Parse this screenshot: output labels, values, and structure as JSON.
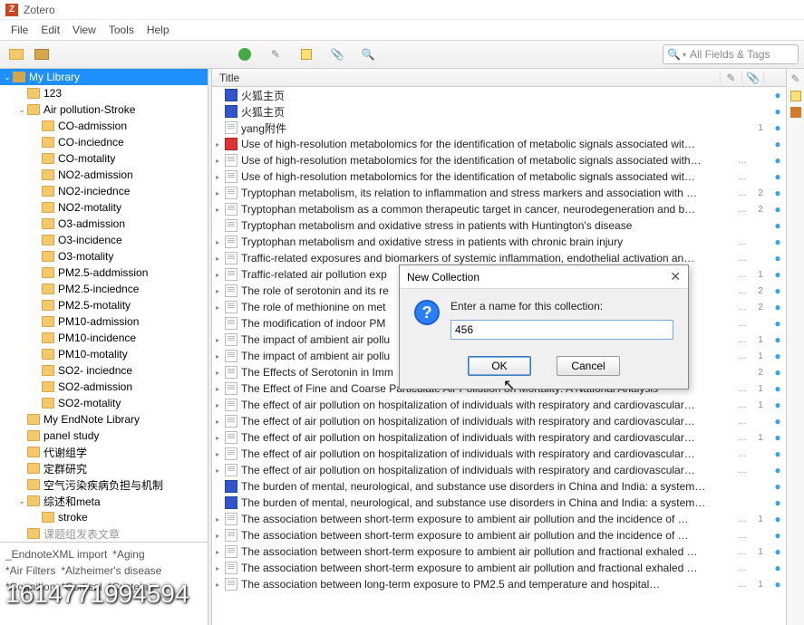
{
  "window": {
    "title": "Zotero"
  },
  "menu": {
    "file": "File",
    "edit": "Edit",
    "view": "View",
    "tools": "Tools",
    "help": "Help"
  },
  "search": {
    "placeholder": "All Fields & Tags"
  },
  "columns": {
    "title": "Title"
  },
  "sidebar": {
    "items": [
      {
        "label": "My Library",
        "depth": 0,
        "open": true,
        "selected": true,
        "lib": true
      },
      {
        "label": "123",
        "depth": 1
      },
      {
        "label": "Air pollution-Stroke",
        "depth": 1,
        "open": true,
        "twisty": "open"
      },
      {
        "label": "CO-admission",
        "depth": 2
      },
      {
        "label": "CO-inciednce",
        "depth": 2
      },
      {
        "label": "CO-motality",
        "depth": 2
      },
      {
        "label": "NO2-admission",
        "depth": 2
      },
      {
        "label": "NO2-inciednce",
        "depth": 2
      },
      {
        "label": "NO2-motality",
        "depth": 2
      },
      {
        "label": "O3-admission",
        "depth": 2
      },
      {
        "label": "O3-incidence",
        "depth": 2
      },
      {
        "label": "O3-motality",
        "depth": 2
      },
      {
        "label": "PM2.5-addmission",
        "depth": 2
      },
      {
        "label": "PM2.5-inciednce",
        "depth": 2
      },
      {
        "label": "PM2.5-motality",
        "depth": 2
      },
      {
        "label": "PM10-admission",
        "depth": 2
      },
      {
        "label": "PM10-incidence",
        "depth": 2
      },
      {
        "label": "PM10-motality",
        "depth": 2
      },
      {
        "label": "SO2- inciednce",
        "depth": 2
      },
      {
        "label": "SO2-admission",
        "depth": 2
      },
      {
        "label": "SO2-motality",
        "depth": 2
      },
      {
        "label": "My EndNote Library",
        "depth": 1
      },
      {
        "label": "panel study",
        "depth": 1
      },
      {
        "label": "代谢组学",
        "depth": 1
      },
      {
        "label": "定群研究",
        "depth": 1
      },
      {
        "label": "空气污染疾病负担与机制",
        "depth": 1
      },
      {
        "label": "综述和meta",
        "depth": 1,
        "open": true,
        "twisty": "open"
      },
      {
        "label": "stroke",
        "depth": 2
      },
      {
        "label": "课题组发表文章",
        "depth": 1,
        "dim": true
      }
    ]
  },
  "tags": [
    "_EndnoteXML import",
    "*Aging",
    "*Air Filters",
    "*Alzheimer's disease",
    "*Cognition",
    "*Cortisol",
    "*Cysteine"
  ],
  "items": [
    {
      "icon": "web",
      "title": "火狐主页",
      "c1": "",
      "c2": "",
      "dot": true
    },
    {
      "icon": "web",
      "title": "火狐主页",
      "c1": "",
      "c2": "",
      "dot": true
    },
    {
      "icon": "paper",
      "title": "yang附件",
      "c1": "",
      "c2": "1",
      "dot": true
    },
    {
      "icon": "pdf",
      "title": "Use of high-resolution metabolomics for the identification of metabolic signals associated wit…",
      "c1": "",
      "c2": "",
      "dot": true,
      "twisty": true
    },
    {
      "icon": "paper",
      "title": "Use of high-resolution metabolomics for the identification of metabolic signals associated with…",
      "c1": "…",
      "c2": "",
      "dot": true,
      "twisty": true
    },
    {
      "icon": "paper",
      "title": "Use of high-resolution metabolomics for the identification of metabolic signals associated wit…",
      "c1": "…",
      "c2": "",
      "dot": true,
      "twisty": true
    },
    {
      "icon": "paper",
      "title": "Tryptophan metabolism, its relation to inflammation and stress markers and association with …",
      "c1": "…",
      "c2": "2",
      "dot": true,
      "twisty": true
    },
    {
      "icon": "paper",
      "title": "Tryptophan metabolism as a common therapeutic target in cancer, neurodegeneration and b…",
      "c1": "…",
      "c2": "2",
      "dot": true,
      "twisty": true
    },
    {
      "icon": "paper",
      "title": "Tryptophan metabolism and oxidative stress in patients with Huntington's disease",
      "c1": "",
      "c2": "",
      "dot": true
    },
    {
      "icon": "paper",
      "title": "Tryptophan metabolism and oxidative stress in patients with chronic brain injury",
      "c1": "…",
      "c2": "",
      "dot": true,
      "twisty": true
    },
    {
      "icon": "paper",
      "title": "Traffic-related exposures and biomarkers of systemic inflammation, endothelial activation an…",
      "c1": "…",
      "c2": "",
      "dot": true,
      "twisty": true
    },
    {
      "icon": "paper",
      "title": "Traffic-related air pollution exp",
      "c1": "…",
      "c2": "1",
      "dot": true,
      "twisty": true
    },
    {
      "icon": "paper",
      "title": "The role of serotonin and its re",
      "c1": "…",
      "c2": "2",
      "dot": true,
      "twisty": true
    },
    {
      "icon": "paper",
      "title": "The role of methionine on met",
      "c1": "…",
      "c2": "2",
      "dot": true,
      "twisty": true
    },
    {
      "icon": "paper",
      "title": "The modification of indoor PM",
      "c1": "…",
      "c2": "",
      "dot": true
    },
    {
      "icon": "paper",
      "title": "The impact of ambient air pollu",
      "c1": "…",
      "c2": "1",
      "dot": true,
      "twisty": true
    },
    {
      "icon": "paper",
      "title": "The impact of ambient air pollu",
      "c1": "…",
      "c2": "1",
      "dot": true,
      "twisty": true
    },
    {
      "icon": "paper",
      "title": "The Effects of Serotonin in Imm",
      "c1": "",
      "c2": "2",
      "dot": true,
      "twisty": true
    },
    {
      "icon": "paper",
      "title": "The Effect of Fine and Coarse Particulate Air Pollution on Mortality: A National Analysis",
      "c1": "…",
      "c2": "1",
      "dot": true,
      "twisty": true
    },
    {
      "icon": "paper",
      "title": "The effect of air pollution on hospitalization of individuals with respiratory and cardiovascular…",
      "c1": "…",
      "c2": "1",
      "dot": true,
      "twisty": true
    },
    {
      "icon": "paper",
      "title": "The effect of air pollution on hospitalization of individuals with respiratory and cardiovascular…",
      "c1": "…",
      "c2": "",
      "dot": true,
      "twisty": true
    },
    {
      "icon": "paper",
      "title": "The effect of air pollution on hospitalization of individuals with respiratory and cardiovascular…",
      "c1": "…",
      "c2": "1",
      "dot": true,
      "twisty": true
    },
    {
      "icon": "paper",
      "title": "The effect of air pollution on hospitalization of individuals with respiratory and cardiovascular…",
      "c1": "…",
      "c2": "",
      "dot": true,
      "twisty": true
    },
    {
      "icon": "paper",
      "title": "The effect of air pollution on hospitalization of individuals with respiratory and cardiovascular…",
      "c1": "…",
      "c2": "",
      "dot": true,
      "twisty": true
    },
    {
      "icon": "web",
      "title": "The burden of mental, neurological, and substance use disorders in China and India: a system…",
      "c1": "",
      "c2": "",
      "dot": true
    },
    {
      "icon": "web",
      "title": "The burden of mental, neurological, and substance use disorders in China and India: a system…",
      "c1": "",
      "c2": "",
      "dot": true
    },
    {
      "icon": "paper",
      "title": "The association between short-term exposure to ambient air pollution and the incidence of …",
      "c1": "…",
      "c2": "1",
      "dot": true,
      "twisty": true
    },
    {
      "icon": "paper",
      "title": "The association between short-term exposure to ambient air pollution and the incidence of …",
      "c1": "…",
      "c2": "",
      "dot": true,
      "twisty": true
    },
    {
      "icon": "paper",
      "title": "The association between short-term exposure to ambient air pollution and fractional exhaled …",
      "c1": "…",
      "c2": "1",
      "dot": true,
      "twisty": true
    },
    {
      "icon": "paper",
      "title": "The association between short-term exposure to ambient air pollution and fractional exhaled …",
      "c1": "…",
      "c2": "",
      "dot": true,
      "twisty": true
    },
    {
      "icon": "paper",
      "title": "The association between long-term exposure to PM2.5 and temperature and hospital…",
      "c1": "…",
      "c2": "1",
      "dot": true,
      "twisty": true
    }
  ],
  "dialog": {
    "title": "New Collection",
    "prompt": "Enter a name for this collection:",
    "value": "456",
    "ok": "OK",
    "cancel": "Cancel"
  },
  "watermark": "1614771994594"
}
